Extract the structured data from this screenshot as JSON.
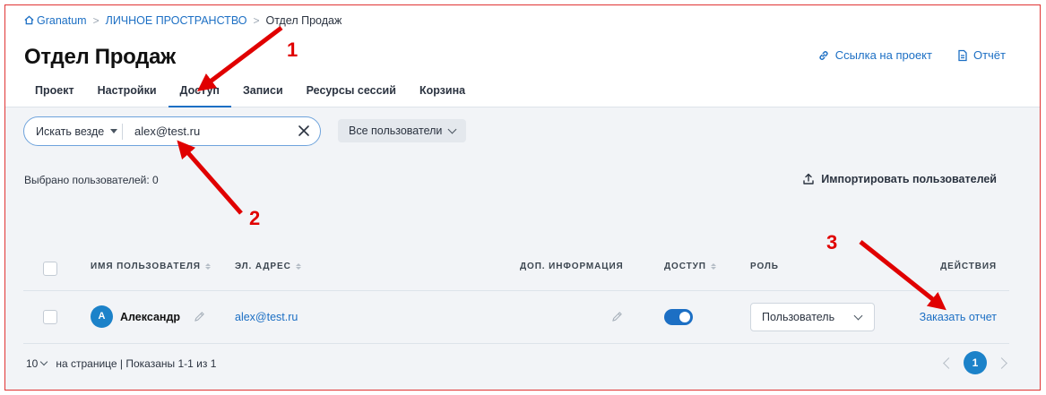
{
  "breadcrumb": {
    "home": "Granatum",
    "space": "ЛИЧНОЕ ПРОСТРАНСТВО",
    "current": "Отдел Продаж"
  },
  "page": {
    "title": "Отдел Продаж"
  },
  "header_links": {
    "project_link": "Ссылка на проект",
    "report": "Отчёт"
  },
  "tabs": [
    {
      "label": "Проект"
    },
    {
      "label": "Настройки"
    },
    {
      "label": "Доступ",
      "active": true
    },
    {
      "label": "Записи"
    },
    {
      "label": "Ресурсы сессий"
    },
    {
      "label": "Корзина"
    }
  ],
  "search": {
    "scope": "Искать везде",
    "value": "alex@test.ru"
  },
  "filter": {
    "label": "Все пользователи"
  },
  "selection": {
    "text": "Выбрано пользователей: 0"
  },
  "import": {
    "label": "Импортировать пользователей"
  },
  "table": {
    "headers": {
      "name": "ИМЯ ПОЛЬЗОВАТЕЛЯ",
      "email": "ЭЛ. АДРЕС",
      "info": "ДОП. ИНФОРМАЦИЯ",
      "access": "ДОСТУП",
      "role": "РОЛЬ",
      "actions": "ДЕЙСТВИЯ"
    },
    "rows": [
      {
        "initial": "А",
        "name": "Александр",
        "email": "alex@test.ru",
        "access": true,
        "role": "Пользователь",
        "action": "Заказать отчет"
      }
    ]
  },
  "pagination": {
    "per_page": "10",
    "per_page_suffix": "на странице | Показаны 1-1 из 1",
    "current_page": "1"
  },
  "annotations": {
    "one": "1",
    "two": "2",
    "three": "3"
  },
  "colors": {
    "accent": "#1c6fc4",
    "annotation": "#e00000",
    "frame": "#e03434"
  }
}
